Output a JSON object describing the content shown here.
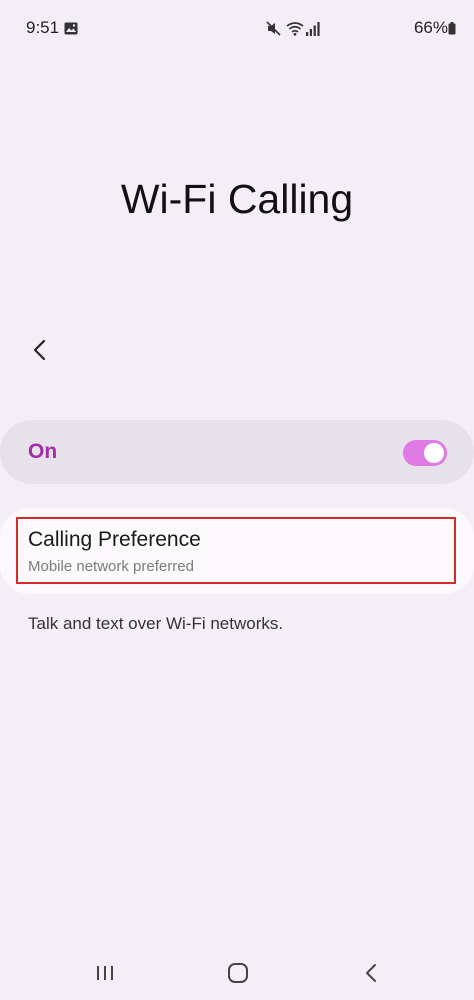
{
  "status_bar": {
    "time": "9:51",
    "battery": "66%"
  },
  "page": {
    "title": "Wi-Fi Calling"
  },
  "toggle": {
    "label": "On",
    "state": true,
    "accent": "#a22ea6",
    "track_color": "#e07be6"
  },
  "calling_preference": {
    "title": "Calling Preference",
    "subtitle": "Mobile network preferred",
    "highlight_color": "#d62a2a"
  },
  "description": "Talk and text over Wi-Fi networks.",
  "icons": {
    "gallery": "gallery-icon",
    "mute": "mute-icon",
    "wifi": "wifi-calling-icon",
    "signal": "signal-icon",
    "battery": "battery-icon",
    "back": "chevron-left-icon",
    "nav_recents": "recents-icon",
    "nav_home": "home-icon",
    "nav_back": "back-icon"
  }
}
